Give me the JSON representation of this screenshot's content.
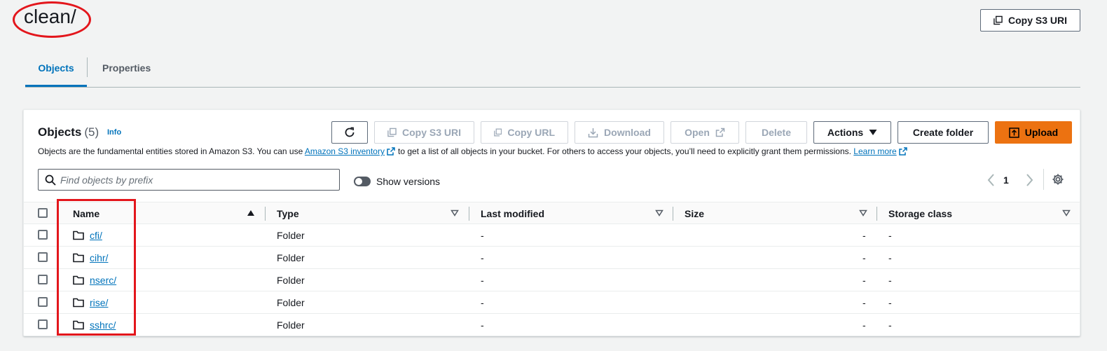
{
  "header": {
    "title": "clean/",
    "copy_s3_uri_label": "Copy S3 URI"
  },
  "tabs": [
    {
      "label": "Objects",
      "active": true
    },
    {
      "label": "Properties",
      "active": false
    }
  ],
  "panel": {
    "title": "Objects",
    "count": "(5)",
    "info": "Info",
    "desc_before": "Objects are the fundamental entities stored in Amazon S3. You can use",
    "desc_link1": "Amazon S3 inventory",
    "desc_middle": "to get a list of all objects in your bucket. For others to access your objects, you’ll need to explicitly grant them permissions.",
    "desc_link2": "Learn more"
  },
  "toolbar": {
    "copy_s3_uri": "Copy S3 URI",
    "copy_url": "Copy URL",
    "download": "Download",
    "open": "Open",
    "delete": "Delete",
    "actions": "Actions",
    "create_folder": "Create folder",
    "upload": "Upload"
  },
  "search": {
    "placeholder": "Find objects by prefix",
    "value": ""
  },
  "show_versions": {
    "label": "Show versions",
    "on": false
  },
  "pagination": {
    "current": "1"
  },
  "table": {
    "columns": [
      "Name",
      "Type",
      "Last modified",
      "Size",
      "Storage class"
    ],
    "rows": [
      {
        "name": "cfi/",
        "type": "Folder",
        "last_modified": "-",
        "size": "-",
        "storage_class": "-"
      },
      {
        "name": "cihr/",
        "type": "Folder",
        "last_modified": "-",
        "size": "-",
        "storage_class": "-"
      },
      {
        "name": "nserc/",
        "type": "Folder",
        "last_modified": "-",
        "size": "-",
        "storage_class": "-"
      },
      {
        "name": "rise/",
        "type": "Folder",
        "last_modified": "-",
        "size": "-",
        "storage_class": "-"
      },
      {
        "name": "sshrc/",
        "type": "Folder",
        "last_modified": "-",
        "size": "-",
        "storage_class": "-"
      }
    ]
  },
  "colors": {
    "accent": "#0073bb",
    "primary_button": "#ec7211",
    "annotation": "#e3161c"
  },
  "icons": [
    "copy-icon",
    "refresh-icon",
    "download-icon",
    "external-link-icon",
    "caret-down-icon",
    "upload-icon",
    "search-icon",
    "chevron-left-icon",
    "chevron-right-icon",
    "gear-icon",
    "sort-asc-icon",
    "sort-desc-icon",
    "folder-icon"
  ]
}
